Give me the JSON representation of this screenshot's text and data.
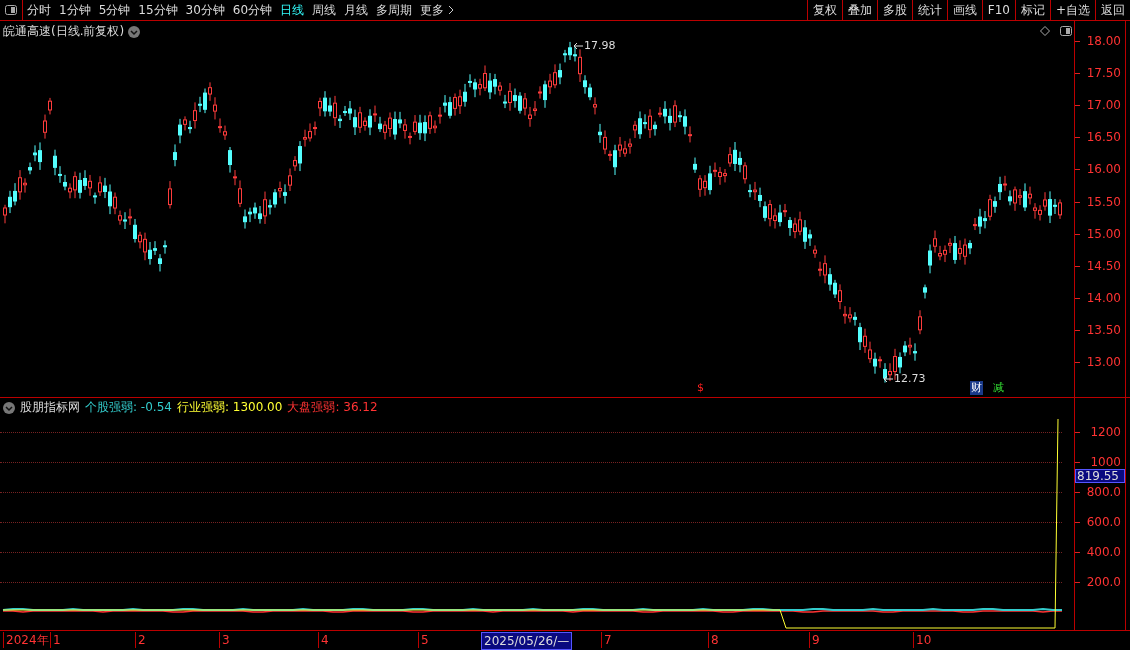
{
  "toolbar": {
    "periods": [
      {
        "label": "分时",
        "selected": false
      },
      {
        "label": "1分钟",
        "selected": false
      },
      {
        "label": "5分钟",
        "selected": false
      },
      {
        "label": "15分钟",
        "selected": false
      },
      {
        "label": "30分钟",
        "selected": false
      },
      {
        "label": "60分钟",
        "selected": false
      },
      {
        "label": "日线",
        "selected": true
      },
      {
        "label": "周线",
        "selected": false
      },
      {
        "label": "月线",
        "selected": false
      },
      {
        "label": "多周期",
        "selected": false
      },
      {
        "label": "更多",
        "selected": false
      }
    ],
    "buttons": [
      "复权",
      "叠加",
      "多股",
      "统计",
      "画线",
      "F10",
      "标记",
      "+自选",
      "返回"
    ]
  },
  "security_title": "皖通高速(日线.前复权)",
  "price_axis": {
    "ticks": [
      "18.00",
      "17.50",
      "17.00",
      "16.50",
      "16.00",
      "15.50",
      "15.00",
      "14.50",
      "14.00",
      "13.50",
      "13.00"
    ]
  },
  "annotations": {
    "high": "17.98",
    "low": "12.73"
  },
  "markers": [
    {
      "text": "$",
      "kind": "alert"
    },
    {
      "text": "财",
      "kind": "tag"
    },
    {
      "text": "减",
      "kind": "notice"
    }
  ],
  "indicator": {
    "name": "股朋指标网",
    "legend": [
      {
        "label": "个股强弱: -0.54",
        "color": "#33cccc"
      },
      {
        "label": "行业强弱: 1300.00",
        "color": "#ffff33"
      },
      {
        "label": "大盘强弱: 36.12",
        "color": "#ff3333"
      }
    ],
    "ticks": [
      "1200",
      "1000",
      "800.0",
      "600.0",
      "400.0",
      "200.0"
    ],
    "current": "819.55"
  },
  "date_axis": [
    {
      "label": "2024年",
      "selected": false
    },
    {
      "label": "1",
      "selected": false
    },
    {
      "label": "2",
      "selected": false
    },
    {
      "label": "3",
      "selected": false
    },
    {
      "label": "4",
      "selected": false
    },
    {
      "label": "5",
      "selected": false
    },
    {
      "label": "2025/05/26/—",
      "selected": true
    },
    {
      "label": "7",
      "selected": false
    },
    {
      "label": "8",
      "selected": false
    },
    {
      "label": "9",
      "selected": false
    },
    {
      "label": "10",
      "selected": false
    }
  ]
}
